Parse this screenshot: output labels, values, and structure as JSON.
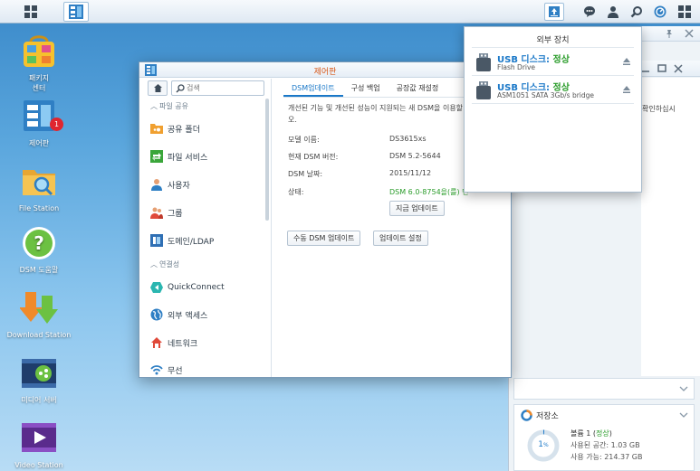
{
  "taskbar": {
    "icons": [
      "main-menu-icon",
      "control-panel-icon",
      "upload-icon",
      "message-icon",
      "user-icon",
      "search-icon",
      "widget-icon",
      "options-icon"
    ]
  },
  "desktop": {
    "icons": [
      {
        "label": "패키지\n센터",
        "line1": "패키지",
        "line2": "센터",
        "icon": "package-center-icon"
      },
      {
        "label": "제어판",
        "icon": "control-panel-icon",
        "badge": "1"
      },
      {
        "label": "File Station",
        "icon": "file-station-icon"
      },
      {
        "label": "DSM 도움말",
        "icon": "dsm-help-icon"
      },
      {
        "label": "Download Station",
        "icon": "download-station-icon"
      },
      {
        "label": "미디어 서버",
        "icon": "media-server-icon"
      },
      {
        "label": "Video Station",
        "icon": "video-station-icon"
      }
    ]
  },
  "control_panel": {
    "title": "제어판",
    "search_placeholder": "검색",
    "sections": {
      "file_sharing": "파일 공유",
      "connectivity": "연결성"
    },
    "sidebar_items": [
      {
        "label": "공유 폴더",
        "icon": "shared-folder-icon"
      },
      {
        "label": "파일 서비스",
        "icon": "file-services-icon"
      },
      {
        "label": "사용자",
        "icon": "user-icon"
      },
      {
        "label": "그룹",
        "icon": "group-icon"
      },
      {
        "label": "도메인/LDAP",
        "icon": "domain-ldap-icon"
      },
      {
        "label": "QuickConnect",
        "icon": "quickconnect-icon"
      },
      {
        "label": "외부 액세스",
        "icon": "external-access-icon"
      },
      {
        "label": "네트워크",
        "icon": "network-icon"
      },
      {
        "label": "무선",
        "icon": "wireless-icon"
      }
    ],
    "tabs": [
      "DSM업데이트",
      "구성 백업",
      "공장값 재설정"
    ],
    "active_tab": "DSM업데이트",
    "description": "개선된 기능 및 개선된 성능이 지원되는 새 DSM을 이용할",
    "description_tail": "오.",
    "info": [
      {
        "label": "모델 이름:",
        "value": "DS3615xs"
      },
      {
        "label": "현재 DSM 버전:",
        "value": "DSM 5.2-5644"
      },
      {
        "label": "DSM 날짜:",
        "value": "2015/11/12"
      },
      {
        "label": "상태:",
        "value": "DSM 6.0-8754을(를) 먼"
      }
    ],
    "buttons": {
      "update_now": "지금 업데이트",
      "manual_update": "수동 DSM 업데이트",
      "update_settings": "업데이트 설정"
    }
  },
  "external_devices": {
    "title": "외부 장치",
    "devices": [
      {
        "name": "USB 디스크:",
        "status": "정상",
        "sub": "Flash Drive"
      },
      {
        "name": "USB 디스크:",
        "status": "정상",
        "sub": "ASM1051 SATA 3Gb/s bridge"
      }
    ]
  },
  "background_window": {
    "partial_text": "확인하십시"
  },
  "storage_widget": {
    "title": "저장소",
    "volume": "볼륨 1",
    "volume_status": "정상",
    "used_label": "사용된 공간: 1.03 GB",
    "avail_label": "사용 가능: 214.37 GB",
    "percent": "1",
    "percent_unit": "%",
    "usage_fraction": 0.01
  },
  "colors": {
    "accent": "#1a78c8",
    "ok_green": "#2a9c2a",
    "title_orange": "#d85a1b"
  }
}
